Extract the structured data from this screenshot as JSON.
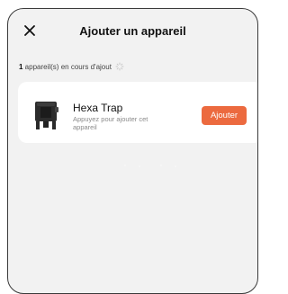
{
  "dialog": {
    "title": "Ajouter un appareil",
    "close_icon": "close-icon"
  },
  "status": {
    "count": "1",
    "text": " appareil(s) en cours d'ajout"
  },
  "device": {
    "name": "Hexa Trap",
    "hint": "Appuyez pour ajouter cet appareil",
    "add_label": "Ajouter",
    "image_icon": "trap-device-icon"
  },
  "colors": {
    "accent": "#ec6a3f",
    "sheet_bg": "#f2f2f2",
    "card_bg": "#ffffff"
  }
}
